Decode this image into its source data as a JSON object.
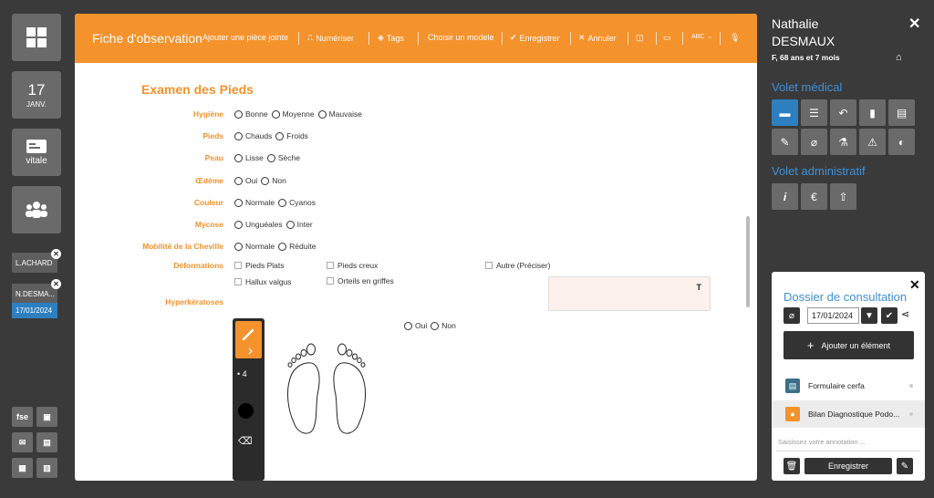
{
  "sidebar": {
    "calendar": {
      "day": "17",
      "month": "JANV."
    },
    "vitale_label": "vitale",
    "folders": [
      {
        "label": "L.ACHARD"
      },
      {
        "label": "N.DESMA...",
        "date": "17/01/2024"
      }
    ],
    "bottom_buttons": [
      "fse"
    ]
  },
  "header": {
    "title": "Fiche d'observation",
    "actions": {
      "add_attachment": "Ajouter une pièce jointe",
      "scan": "Numériser",
      "tags": "Tags",
      "choose_model": "Choisir un modele",
      "save": "Enregistrer",
      "cancel": "Annuler",
      "spell": "ABC"
    }
  },
  "form": {
    "title": "Examen des Pieds",
    "rows": [
      {
        "label": "Hygiène",
        "options": [
          "Bonne",
          "Moyenne",
          "Mauvaise"
        ]
      },
      {
        "label": "Pieds",
        "options": [
          "Chauds",
          "Froids"
        ]
      },
      {
        "label": "Peau",
        "options": [
          "Lisse",
          "Sèche"
        ]
      },
      {
        "label": "Œdème",
        "options": [
          "Oui",
          "Non"
        ]
      },
      {
        "label": "Couleur",
        "options": [
          "Normale",
          "Cyanos"
        ]
      },
      {
        "label": "Mycose",
        "options": [
          "Unguéales",
          "Inter"
        ]
      },
      {
        "label": "Mobilité de la Cheville",
        "options": [
          "Normale",
          "Réduite"
        ]
      }
    ],
    "deformations": {
      "label": "Déformations",
      "options": [
        "Pieds Plats",
        "Pieds creux",
        "Autre (Préciser)",
        "Hallux valgus",
        "Orteils en griffes"
      ]
    },
    "hyperkeratoses": {
      "label": "Hyperkératoses",
      "text_format_icon": "T",
      "options": [
        "Oui",
        "Non"
      ]
    },
    "drawing_tool": {
      "brush_size": "4"
    }
  },
  "patient": {
    "first_name": "Nathalie",
    "last_name": "DESMAUX",
    "info": "F, 68 ans et 7 mois"
  },
  "sections": {
    "medical": "Volet médical",
    "admin": "Volet administratif",
    "admin_icons": [
      "i",
      "€"
    ]
  },
  "dossier": {
    "title": "Dossier de consultation",
    "date": "17/01/2024",
    "add_label": "Ajouter un élément",
    "items": [
      {
        "label": "Formulaire cerfa",
        "color": "#3a6f8a"
      },
      {
        "label": "Bilan Diagnostique Podo...",
        "color": "#f4922c"
      }
    ],
    "annotation_placeholder": "Saisissez votre annotation ...",
    "save_label": "Enregistrer"
  },
  "colors": {
    "accent": "#f4922c",
    "blue": "#2d7fc0",
    "panel": "#3a3a3a"
  }
}
